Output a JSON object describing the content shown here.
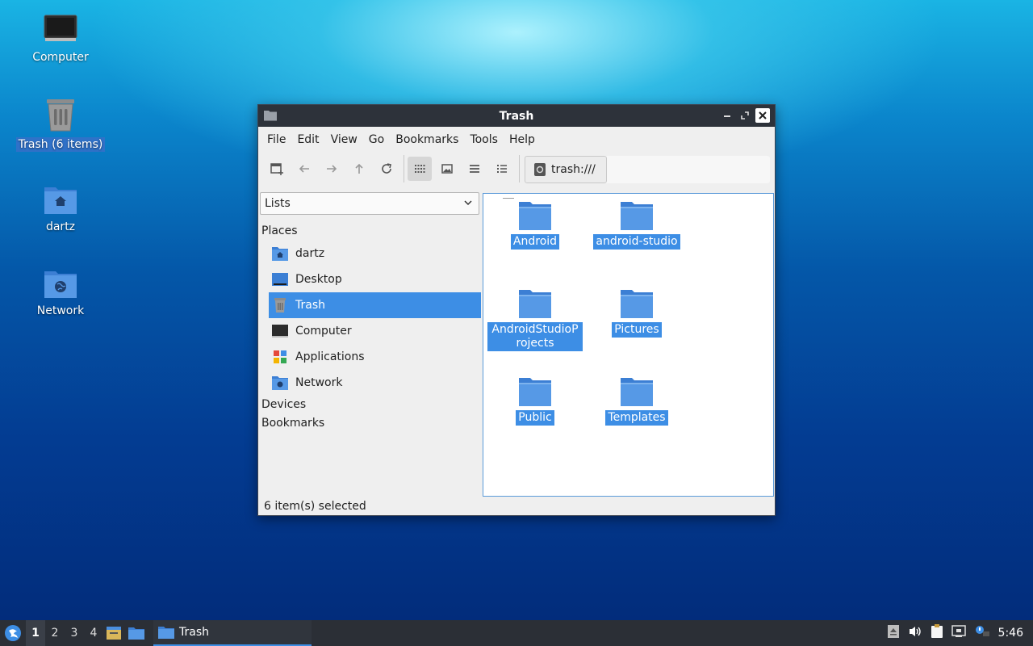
{
  "desktop": {
    "icons": [
      {
        "label": "Computer"
      },
      {
        "label": "Trash (6 items)"
      },
      {
        "label": "dartz"
      },
      {
        "label": "Network"
      }
    ]
  },
  "window": {
    "title": "Trash",
    "menu": [
      "File",
      "Edit",
      "View",
      "Go",
      "Bookmarks",
      "Tools",
      "Help"
    ],
    "toolbar": {
      "icons": [
        "new-window-icon",
        "back-icon",
        "forward-icon",
        "up-icon",
        "reload-icon",
        "icon-view-icon",
        "thumbnail-view-icon",
        "compact-view-icon",
        "detailed-view-icon"
      ]
    },
    "location": {
      "path": "trash:///"
    },
    "sidebar": {
      "dropdown_value": "Lists",
      "places_heading": "Places",
      "places": [
        {
          "label": "dartz"
        },
        {
          "label": "Desktop"
        },
        {
          "label": "Trash"
        },
        {
          "label": "Computer"
        },
        {
          "label": "Applications"
        },
        {
          "label": "Network"
        }
      ],
      "devices_heading": "Devices",
      "bookmarks_heading": "Bookmarks"
    },
    "files": [
      {
        "name": "Android"
      },
      {
        "name": "android-studio"
      },
      {
        "name": "AndroidStudioProjects"
      },
      {
        "name": "Pictures"
      },
      {
        "name": "Public"
      },
      {
        "name": "Templates"
      }
    ],
    "status": "6 item(s) selected"
  },
  "taskbar": {
    "workspaces": [
      "1",
      "2",
      "3",
      "4"
    ],
    "active_workspace": "1",
    "task_label": "Trash",
    "clock": "5:46"
  },
  "colors": {
    "selection": "#3d8ee5",
    "folder": "#4a8fe0",
    "titlebar": "#2d323a",
    "taskbar": "#2b2f36"
  }
}
